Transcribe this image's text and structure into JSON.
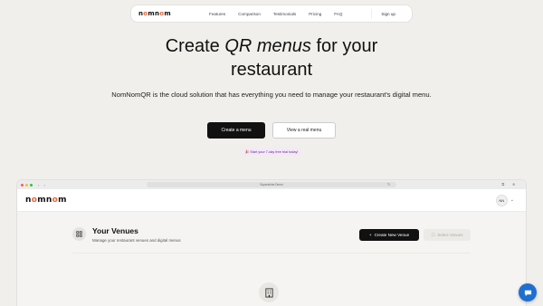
{
  "nav": {
    "logo": "nomnom",
    "links": [
      "Features",
      "Comparison",
      "Testimonials",
      "Pricing",
      "FAQ"
    ],
    "signup": "Sign up"
  },
  "hero": {
    "title_pre": "Create ",
    "title_em": "QR menus",
    "title_post": " for your",
    "title_line2": "restaurant",
    "subtitle": "NomNomQR is the cloud solution that has everything you need to manage your restaurant's digital menu.",
    "cta_primary": "Create a menu",
    "cta_secondary": "View a real menu",
    "trial_badge": "🎉 Start your 7-day free trial today!"
  },
  "browser": {
    "url": "Supershine Demo",
    "app": {
      "logo": "nomnom",
      "avatar": "NN",
      "venues_title": "Your Venues",
      "venues_subtitle": "Manage your restaurant venues and digital menus",
      "create_venue": "Create New Venue",
      "select_venues": "Select Venues"
    }
  },
  "colors": {
    "background": "#f1efeb",
    "primary_button": "#111111",
    "logo_accent": "#e8643c",
    "chat_bubble": "#1f6fd0",
    "badge_bg": "#f3e9f7",
    "badge_text": "#6b2b86"
  },
  "icons": {
    "chat": "chat-icon",
    "venue": "grid-icon",
    "empty_state": "building-icon"
  }
}
